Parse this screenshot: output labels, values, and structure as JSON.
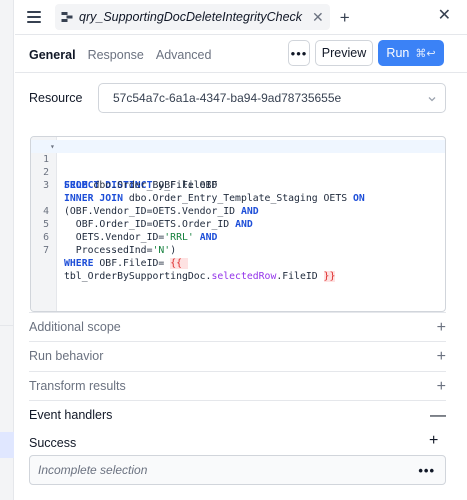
{
  "tab": {
    "title": "qry_SupportingDocDeleteIntegrityCheck"
  },
  "subtabs": [
    {
      "label": "General"
    },
    {
      "label": "Response"
    },
    {
      "label": "Advanced"
    }
  ],
  "actions": {
    "more": "•••",
    "preview": "Preview",
    "run": "Run",
    "run_shortcut": "⌘↩"
  },
  "resource": {
    "label": "Resource",
    "value": "57c54a7c-6a1a-4347-ba94-9ad78735655e"
  },
  "editor": {
    "line_numbers": [
      "1",
      "2",
      "3",
      "",
      "4",
      "5",
      "6",
      "7",
      ""
    ],
    "code_lines": [
      "SELECT DISTINCT OBF.FileID",
      "FROM dbo.Order_By_File OBF",
      "INNER JOIN dbo.Order_Entry_Template_Staging OETS ON",
      "(OBF.Vendor_ID=OETS.Vendor_ID AND",
      "  OBF.Order_ID=OETS.Order_ID AND",
      "  OETS.Vendor_ID='RRL' AND",
      "  ProcessedInd='N')",
      "WHERE OBF.FileID= {{ ",
      "tbl_OrderBySupportingDoc.selectedRow.FileID }}"
    ]
  },
  "sections": [
    {
      "label": "Additional scope",
      "sign": "+"
    },
    {
      "label": "Run behavior",
      "sign": "+"
    },
    {
      "label": "Transform results",
      "sign": "+"
    },
    {
      "label": "Event handlers",
      "sign": "—"
    }
  ],
  "event_handlers": {
    "success_label": "Success",
    "add": "+",
    "handler_text": "Incomplete selection",
    "handler_more": "•••"
  },
  "icons": {
    "menu": "hamburger-icon",
    "query": "query-icon",
    "close": "close-icon",
    "add": "plus-icon",
    "dropdown": "chevron-down-icon"
  },
  "colors": {
    "accent": "#3b82f6",
    "keyword": "#1d4ed8",
    "string": "#15803d",
    "template": "#dc2626"
  }
}
